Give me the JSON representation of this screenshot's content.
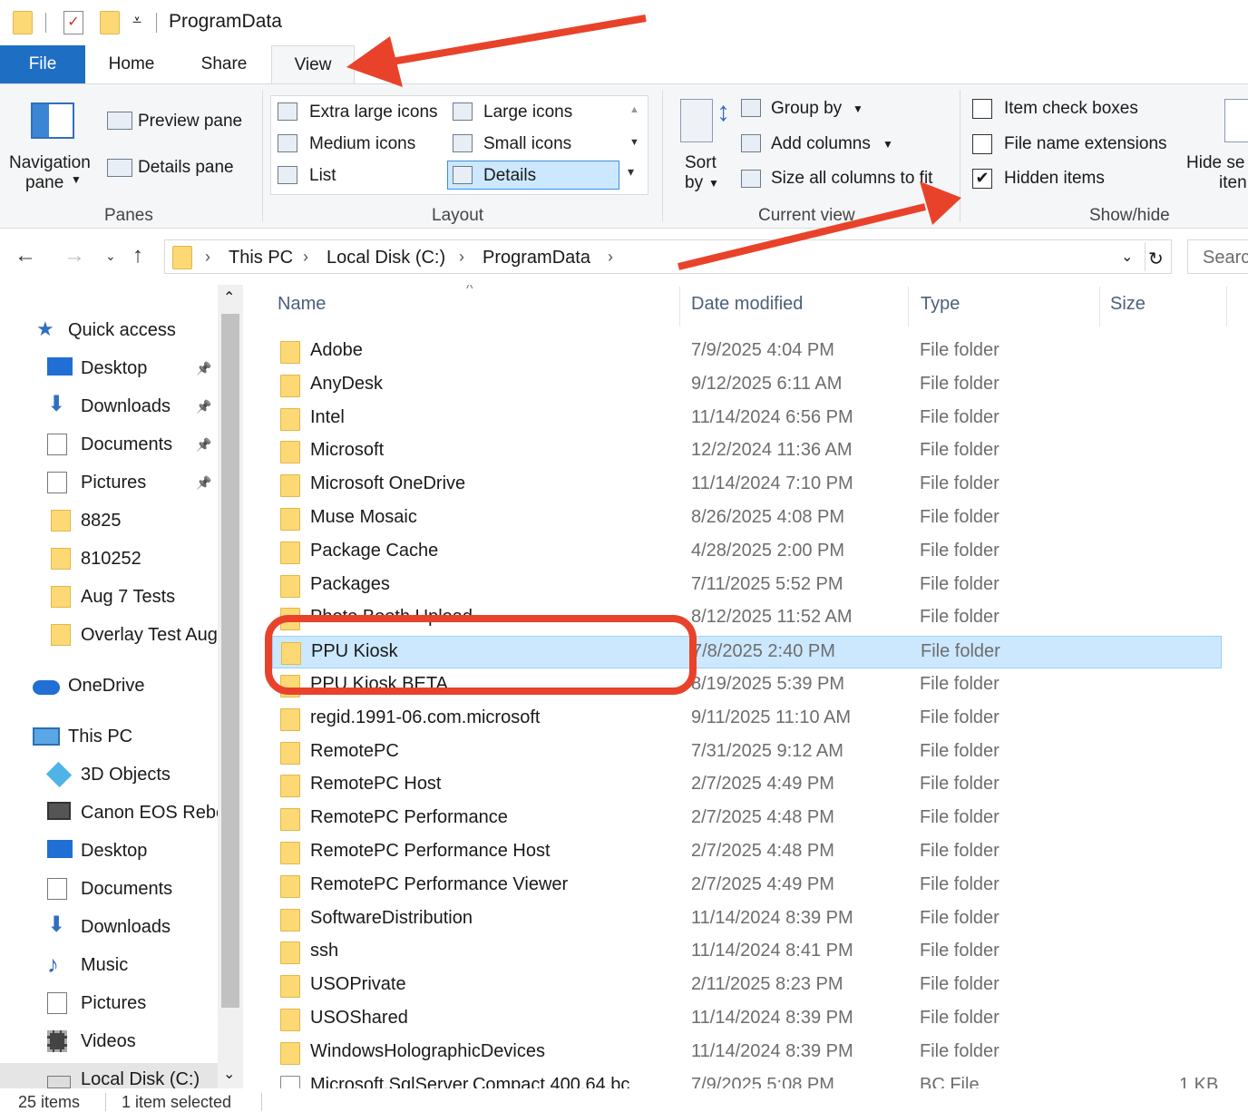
{
  "window": {
    "title": "ProgramData"
  },
  "tabs": [
    {
      "label": "File"
    },
    {
      "label": "Home"
    },
    {
      "label": "Share"
    },
    {
      "label": "View"
    }
  ],
  "ribbon": {
    "panes": {
      "navigation_pane_line1": "Navigation",
      "navigation_pane_line2": "pane",
      "preview_pane": "Preview pane",
      "details_pane": "Details pane",
      "group_label": "Panes"
    },
    "layout": {
      "extra_large_icons": "Extra large icons",
      "large_icons": "Large icons",
      "medium_icons": "Medium icons",
      "small_icons": "Small icons",
      "list": "List",
      "details": "Details",
      "group_label": "Layout"
    },
    "current_view": {
      "sort_by_line1": "Sort",
      "sort_by_line2": "by",
      "group_by": "Group by",
      "add_columns": "Add columns",
      "size_all_columns": "Size all columns to fit",
      "group_label": "Current view"
    },
    "show_hide": {
      "item_check_boxes": "Item check boxes",
      "file_name_extensions": "File name extensions",
      "hidden_items": "Hidden items",
      "hidden_items_checked": true,
      "hide_selected_line1": "Hide se",
      "hide_selected_line2": "iten",
      "group_label": "Show/hide"
    }
  },
  "address": {
    "crumbs": [
      "This PC",
      "Local Disk (C:)",
      "ProgramData"
    ],
    "search_placeholder": "Searc"
  },
  "nav": {
    "quick_access": "Quick access",
    "quick_items": [
      "Desktop",
      "Downloads",
      "Documents",
      "Pictures",
      "8825",
      "810252",
      "Aug 7 Tests",
      "Overlay Test Aug"
    ],
    "onedrive": "OneDrive",
    "this_pc": "This PC",
    "pc_items": [
      "3D Objects",
      "Canon EOS Rebe",
      "Desktop",
      "Documents",
      "Downloads",
      "Music",
      "Pictures",
      "Videos",
      "Local Disk (C:)"
    ]
  },
  "columns": {
    "name": "Name",
    "date": "Date modified",
    "type": "Type",
    "size": "Size"
  },
  "files": [
    {
      "name": "Adobe",
      "date": "7/9/2025 4:04 PM",
      "type": "File folder",
      "size": ""
    },
    {
      "name": "AnyDesk",
      "date": "9/12/2025 6:11 AM",
      "type": "File folder",
      "size": ""
    },
    {
      "name": "Intel",
      "date": "11/14/2024 6:56 PM",
      "type": "File folder",
      "size": ""
    },
    {
      "name": "Microsoft",
      "date": "12/2/2024 11:36 AM",
      "type": "File folder",
      "size": ""
    },
    {
      "name": "Microsoft OneDrive",
      "date": "11/14/2024 7:10 PM",
      "type": "File folder",
      "size": ""
    },
    {
      "name": "Muse Mosaic",
      "date": "8/26/2025 4:08 PM",
      "type": "File folder",
      "size": ""
    },
    {
      "name": "Package Cache",
      "date": "4/28/2025 2:00 PM",
      "type": "File folder",
      "size": ""
    },
    {
      "name": "Packages",
      "date": "7/11/2025 5:52 PM",
      "type": "File folder",
      "size": ""
    },
    {
      "name": "Photo Booth Upload",
      "date": "8/12/2025 11:52 AM",
      "type": "File folder",
      "size": ""
    },
    {
      "name": "PPU Kiosk",
      "date": "7/8/2025 2:40 PM",
      "type": "File folder",
      "size": "",
      "selected": true
    },
    {
      "name": "PPU Kiosk BETA",
      "date": "8/19/2025 5:39 PM",
      "type": "File folder",
      "size": ""
    },
    {
      "name": "regid.1991-06.com.microsoft",
      "date": "9/11/2025 11:10 AM",
      "type": "File folder",
      "size": ""
    },
    {
      "name": "RemotePC",
      "date": "7/31/2025 9:12 AM",
      "type": "File folder",
      "size": ""
    },
    {
      "name": "RemotePC Host",
      "date": "2/7/2025 4:49 PM",
      "type": "File folder",
      "size": ""
    },
    {
      "name": "RemotePC Performance",
      "date": "2/7/2025 4:48 PM",
      "type": "File folder",
      "size": ""
    },
    {
      "name": "RemotePC Performance Host",
      "date": "2/7/2025 4:48 PM",
      "type": "File folder",
      "size": ""
    },
    {
      "name": "RemotePC Performance Viewer",
      "date": "2/7/2025 4:49 PM",
      "type": "File folder",
      "size": ""
    },
    {
      "name": "SoftwareDistribution",
      "date": "11/14/2024 8:39 PM",
      "type": "File folder",
      "size": ""
    },
    {
      "name": "ssh",
      "date": "11/14/2024 8:41 PM",
      "type": "File folder",
      "size": ""
    },
    {
      "name": "USOPrivate",
      "date": "2/11/2025 8:23 PM",
      "type": "File folder",
      "size": ""
    },
    {
      "name": "USOShared",
      "date": "11/14/2024 8:39 PM",
      "type": "File folder",
      "size": ""
    },
    {
      "name": "WindowsHolographicDevices",
      "date": "11/14/2024 8:39 PM",
      "type": "File folder",
      "size": ""
    },
    {
      "name": "Microsoft.SqlServer.Compact.400.64.bc",
      "date": "7/9/2025 5:08 PM",
      "type": "BC File",
      "size": "1 KB",
      "is_file": true
    }
  ],
  "status": {
    "count": "25 items",
    "selected": "1 item selected"
  },
  "colors": {
    "accent": "#1e6fc4",
    "selection": "#cce8ff",
    "annotation": "#e8432a"
  }
}
